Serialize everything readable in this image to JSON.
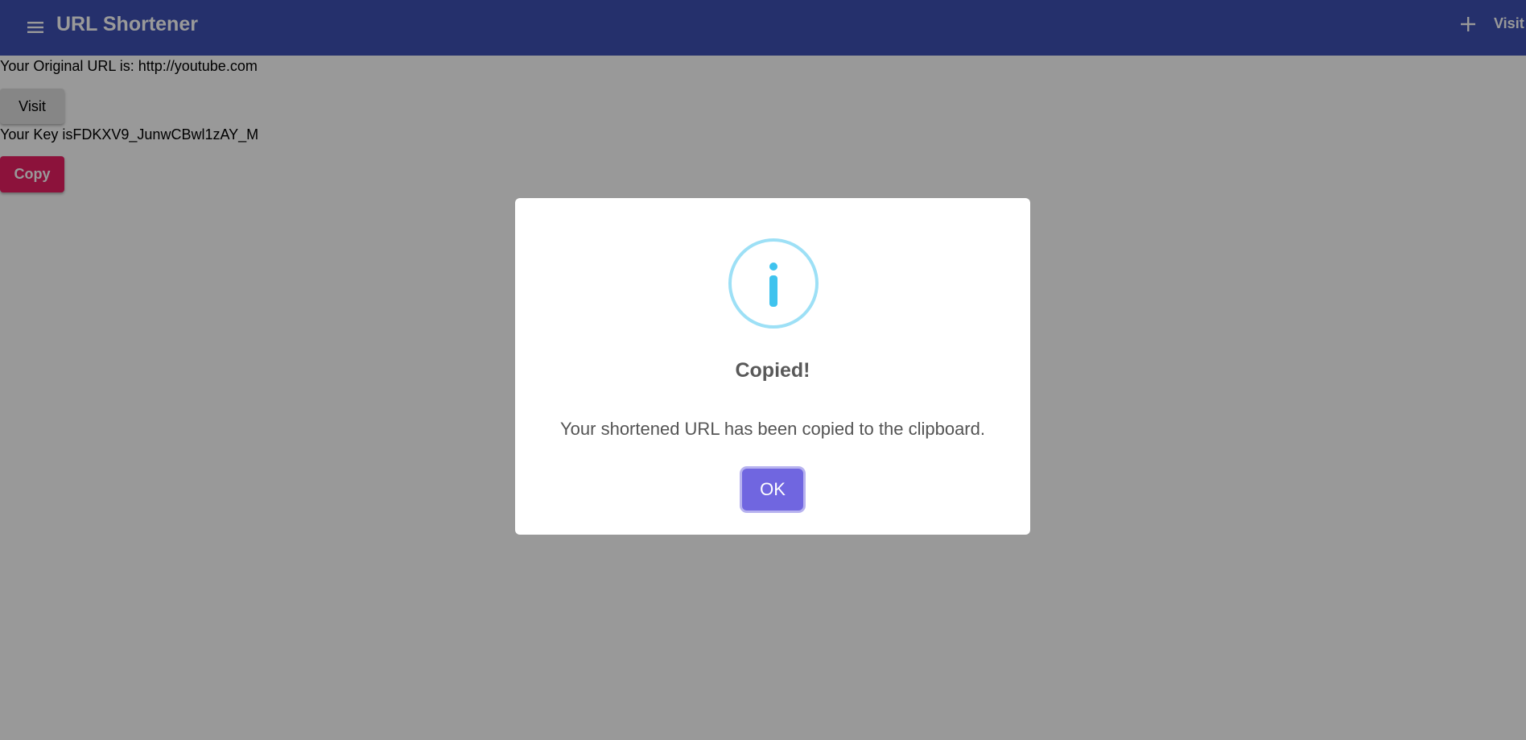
{
  "header": {
    "menu_icon": "menu-icon",
    "title": "URL Shortener",
    "add_icon": "plus-icon",
    "visit_label": "Visit"
  },
  "main": {
    "original_url_text": "Your Original URL is: http://youtube.com",
    "visit_button_label": "Visit",
    "key_text": "Your Key isFDKXV9_JunwCBwl1zAY_M",
    "copy_button_label": "Copy"
  },
  "dialog": {
    "icon": "info-icon",
    "title": "Copied!",
    "message": "Your shortened URL has been copied to the clipboard.",
    "ok_label": "OK"
  },
  "colors": {
    "appbar": "#3f51b5",
    "copy_button": "#e91e63",
    "ok_button": "#7066e0",
    "info_icon": "#3fc3ee"
  }
}
